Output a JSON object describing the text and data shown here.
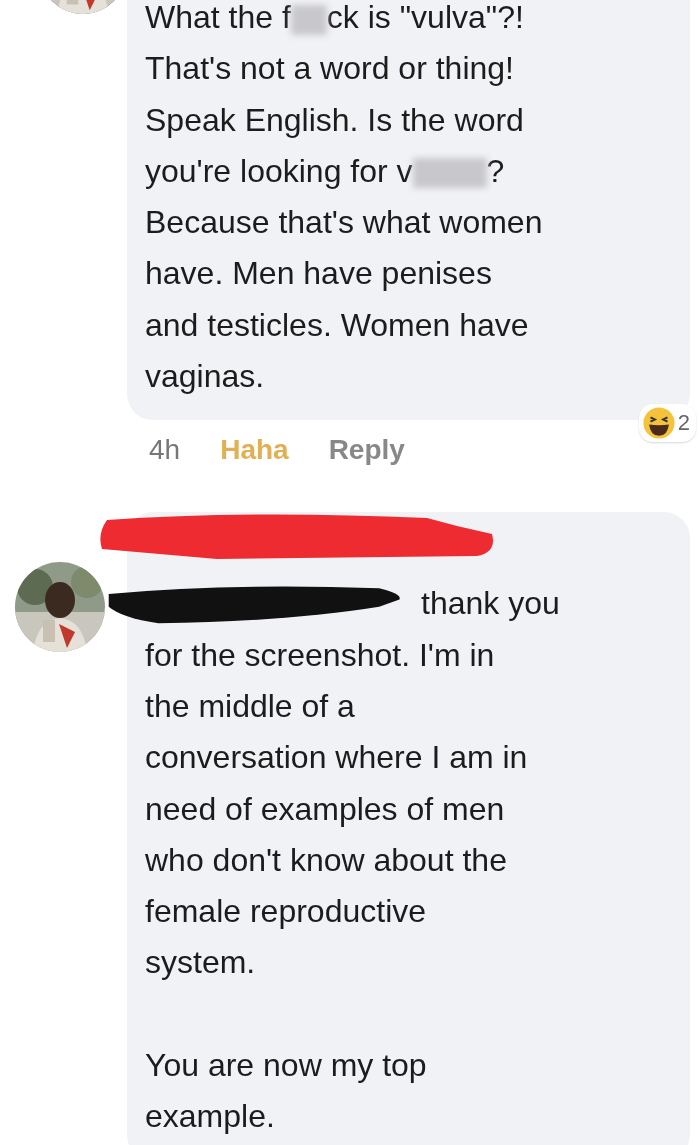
{
  "comments": [
    {
      "avatar": {
        "kind": "picture"
      },
      "parts": [
        {
          "kind": "text",
          "text": "What the f"
        },
        {
          "kind": "blur"
        },
        {
          "kind": "text",
          "text": "ck is \"vulva\"?!\nThat's not a word or thing!\nSpeak English. Is the word\nyou're looking for v"
        },
        {
          "kind": "blur"
        },
        {
          "kind": "text",
          "text": "?\nBecause that's what women\nhave. Men have penises\nand testicles. Women have\nvaginas."
        }
      ],
      "meta": {
        "time": "4h",
        "reaction": {
          "label": "Haha",
          "selected": true
        },
        "reply": "Reply",
        "reaction_count": "2"
      }
    },
    {
      "avatar": {
        "kind": "picture"
      },
      "parts": [
        {
          "kind": "name_redaction"
        },
        {
          "kind": "scribble"
        },
        {
          "kind": "inline_text",
          "text": "thank you"
        },
        {
          "kind": "text",
          "text": "for the screenshot. I'm in\nthe middle of a\nconversation where I am in\nneed of examples of men\nwho don't know  about the\nfemale reproductive\nsystem.\n\nYou are now my top\nexample."
        }
      ]
    }
  ]
}
